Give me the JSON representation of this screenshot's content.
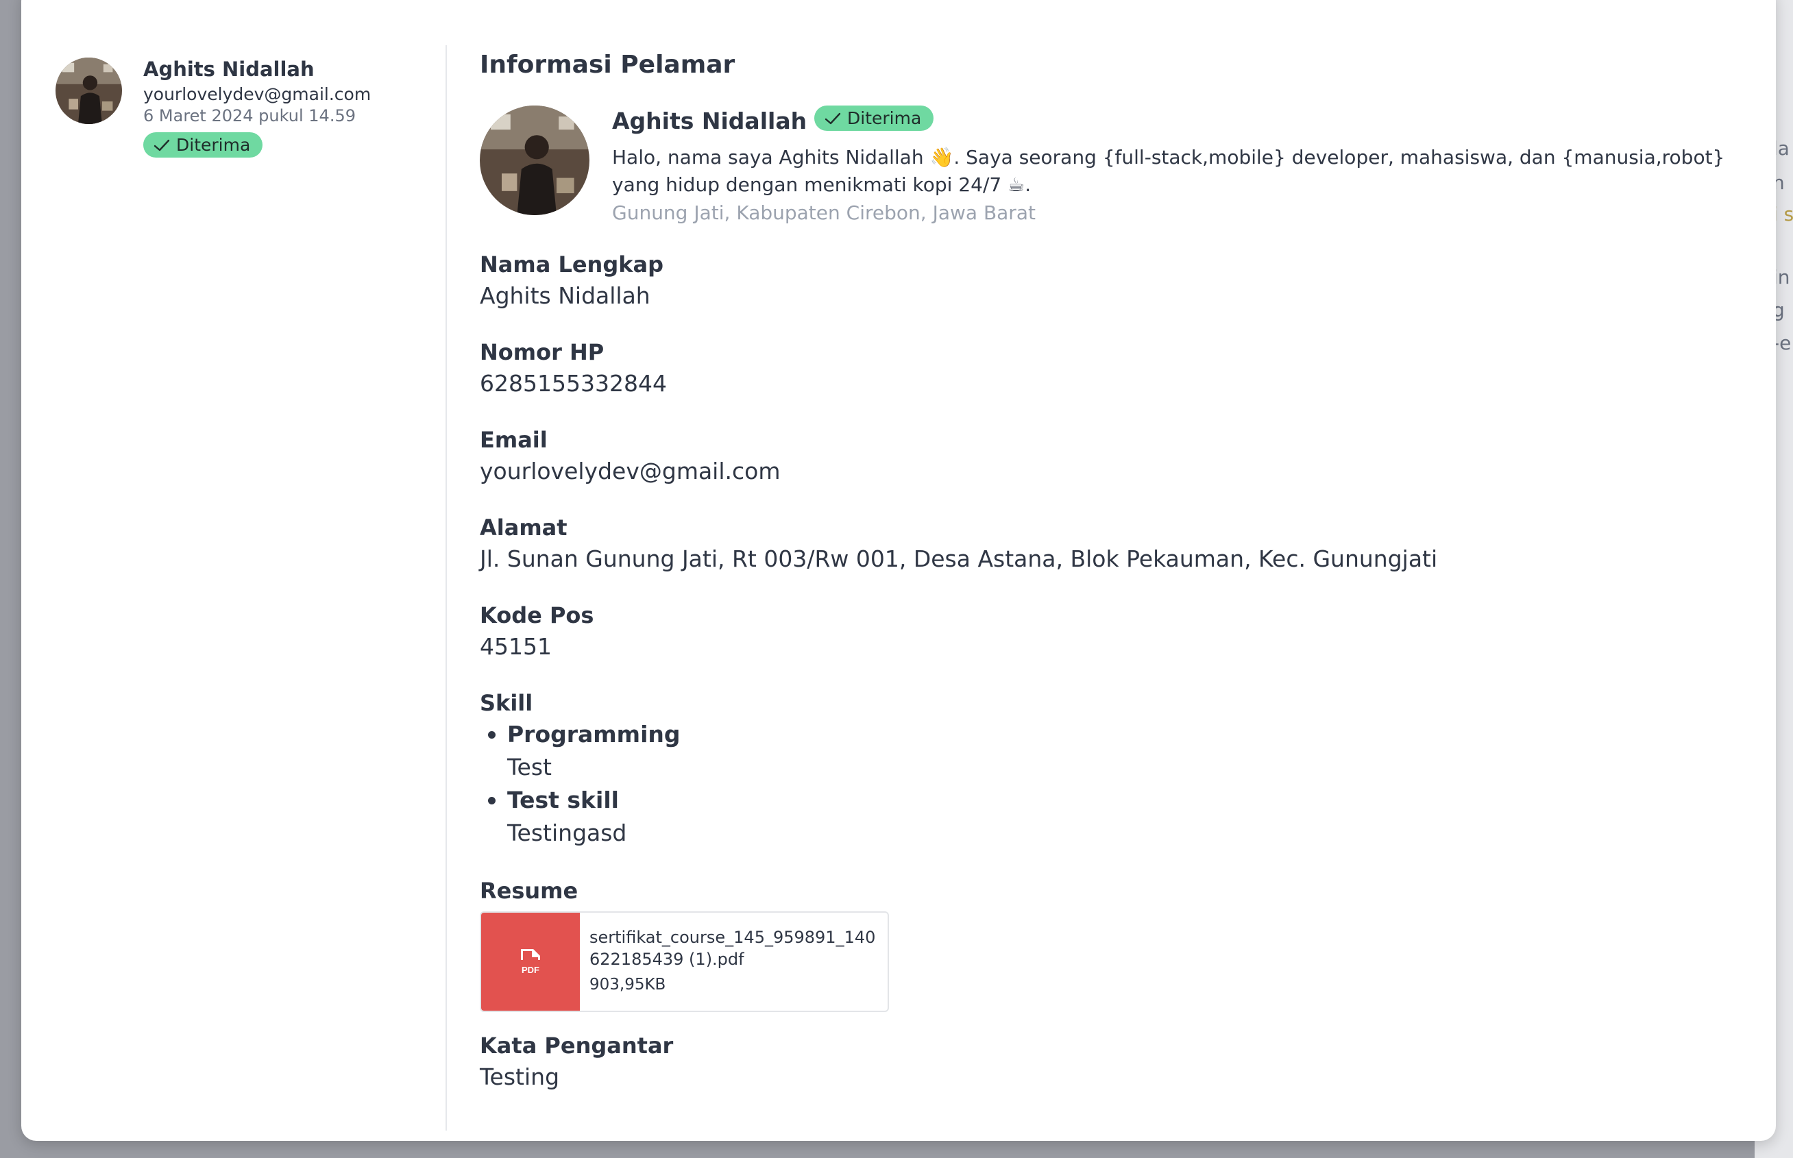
{
  "background_page": {
    "fragments": [
      "la",
      "n",
      "i s",
      "in",
      "g",
      "-e"
    ]
  },
  "applicant_list_item": {
    "name": "Aghits Nidallah",
    "email": "yourlovelydev@gmail.com",
    "date": "6 Maret 2024 pukul 14.59",
    "status": "Diterima"
  },
  "detail": {
    "section_title": "Informasi Pelamar",
    "profile": {
      "name": "Aghits Nidallah",
      "status": "Diterima",
      "bio": "Halo, nama saya Aghits Nidallah 👋. Saya seorang {full-stack,mobile} developer, mahasiswa, dan {manusia,robot} yang hidup dengan menikmati kopi 24/7 ☕.",
      "location": "Gunung Jati, Kabupaten Cirebon, Jawa Barat"
    },
    "fields": {
      "full_name": {
        "label": "Nama Lengkap",
        "value": "Aghits Nidallah"
      },
      "phone": {
        "label": "Nomor HP",
        "value": "6285155332844"
      },
      "email": {
        "label": "Email",
        "value": "yourlovelydev@gmail.com"
      },
      "address": {
        "label": "Alamat",
        "value": "Jl. Sunan Gunung Jati, Rt 003/Rw 001, Desa Astana, Blok Pekauman, Kec. Gunungjati"
      },
      "postal_code": {
        "label": "Kode Pos",
        "value": "45151"
      },
      "cover_letter": {
        "label": "Kata Pengantar",
        "value": "Testing"
      }
    },
    "skill": {
      "label": "Skill",
      "items": [
        {
          "name": "Programming",
          "description": "Test"
        },
        {
          "name": "Test skill",
          "description": "Testingasd"
        }
      ]
    },
    "resume": {
      "label": "Resume",
      "file_type": "PDF",
      "file_name": "sertifikat_course_145_959891_140622185439 (1).pdf",
      "file_size": "903,95KB"
    }
  },
  "colors": {
    "badge_bg": "#6fd9a1",
    "pdf_bg": "#e2524f",
    "overlay": "#9a9ca3",
    "text": "#2f3644",
    "muted": "#9ca3af"
  },
  "icons": {
    "check": "check-icon",
    "pdf": "pdf-file-icon"
  }
}
